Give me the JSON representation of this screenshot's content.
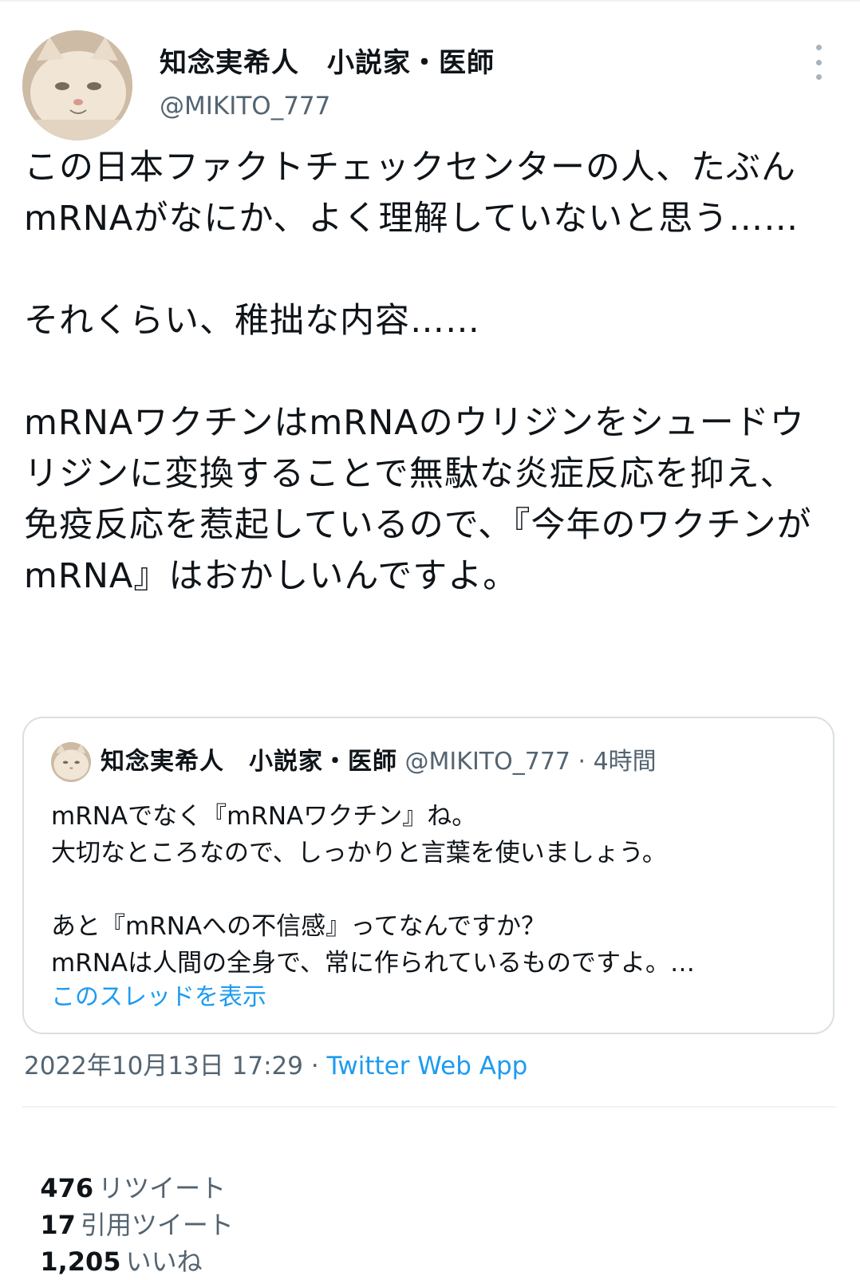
{
  "tweet": {
    "author": {
      "display_name": "知念実希人　小説家・医師",
      "handle": "@MIKITO_777",
      "avatar": "cat-avatar"
    },
    "text": "この日本ファクトチェックセンターの人、たぶんmRNAがなにか、よく理解していないと思う……\n\nそれくらい、稚拙な内容……\n\nmRNAワクチンはmRNAのウリジンをシュードウリジンに変換することで無駄な炎症反応を抑え、免疫反応を惹起しているので、『今年のワクチンがmRNA』はおかしいんですよ。",
    "more_icon": "more-options-icon"
  },
  "quote": {
    "display_name": "知念実希人　小説家・医師",
    "meta": " @MIKITO_777 · 4時間",
    "text": "mRNAでなく『mRNAワクチン』ね。\n大切なところなので、しっかりと言葉を使いましょう。\n\nあと『mRNAへの不信感』ってなんですか？\nmRNAは人間の全身で、常に作られているものですよ。…",
    "show_thread": "このスレッドを表示"
  },
  "timestamp": {
    "datetime": "2022年10月13日 17:29 · ",
    "client": "Twitter Web App"
  },
  "stats": {
    "retweets_count": "476",
    "retweets_label": "リツイート",
    "quotes_count": "17",
    "quotes_label": "引用ツイート",
    "likes_count": "1,205",
    "likes_label": "いいね"
  },
  "colors": {
    "link": "#1d9bf0",
    "secondary_text": "#536471",
    "border": "#d9dfe3"
  }
}
